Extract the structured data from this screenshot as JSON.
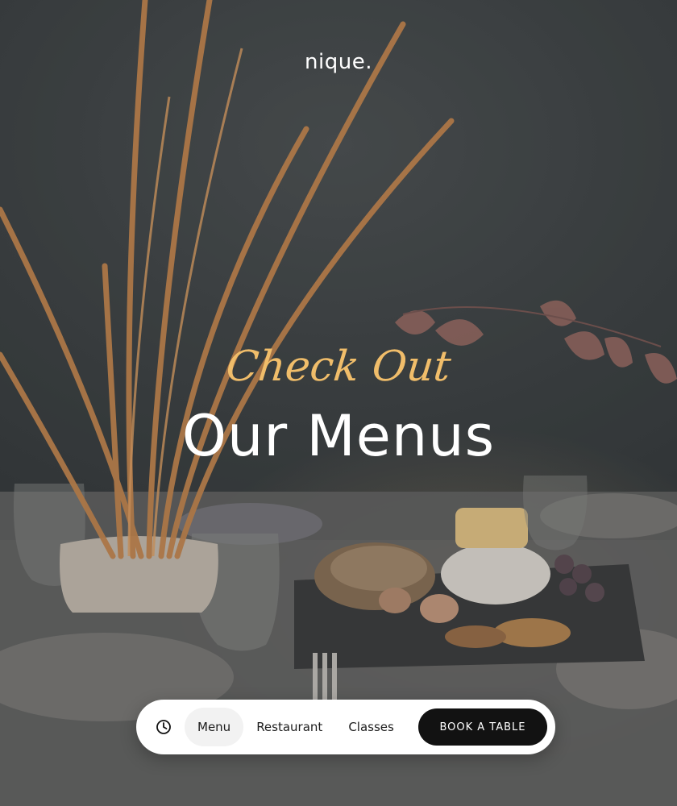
{
  "brand": {
    "logo_text": "nique."
  },
  "hero": {
    "kicker": "Check Out",
    "title": "Our Menus",
    "kicker_color": "#f0bd6a",
    "title_color": "#ffffff"
  },
  "nav": {
    "clock_icon": "clock-icon",
    "items": [
      {
        "label": "Menu",
        "active": true
      },
      {
        "label": "Restaurant",
        "active": false
      },
      {
        "label": "Classes",
        "active": false
      }
    ],
    "cta_label": "BOOK A TABLE",
    "cta_color": "#121212"
  }
}
